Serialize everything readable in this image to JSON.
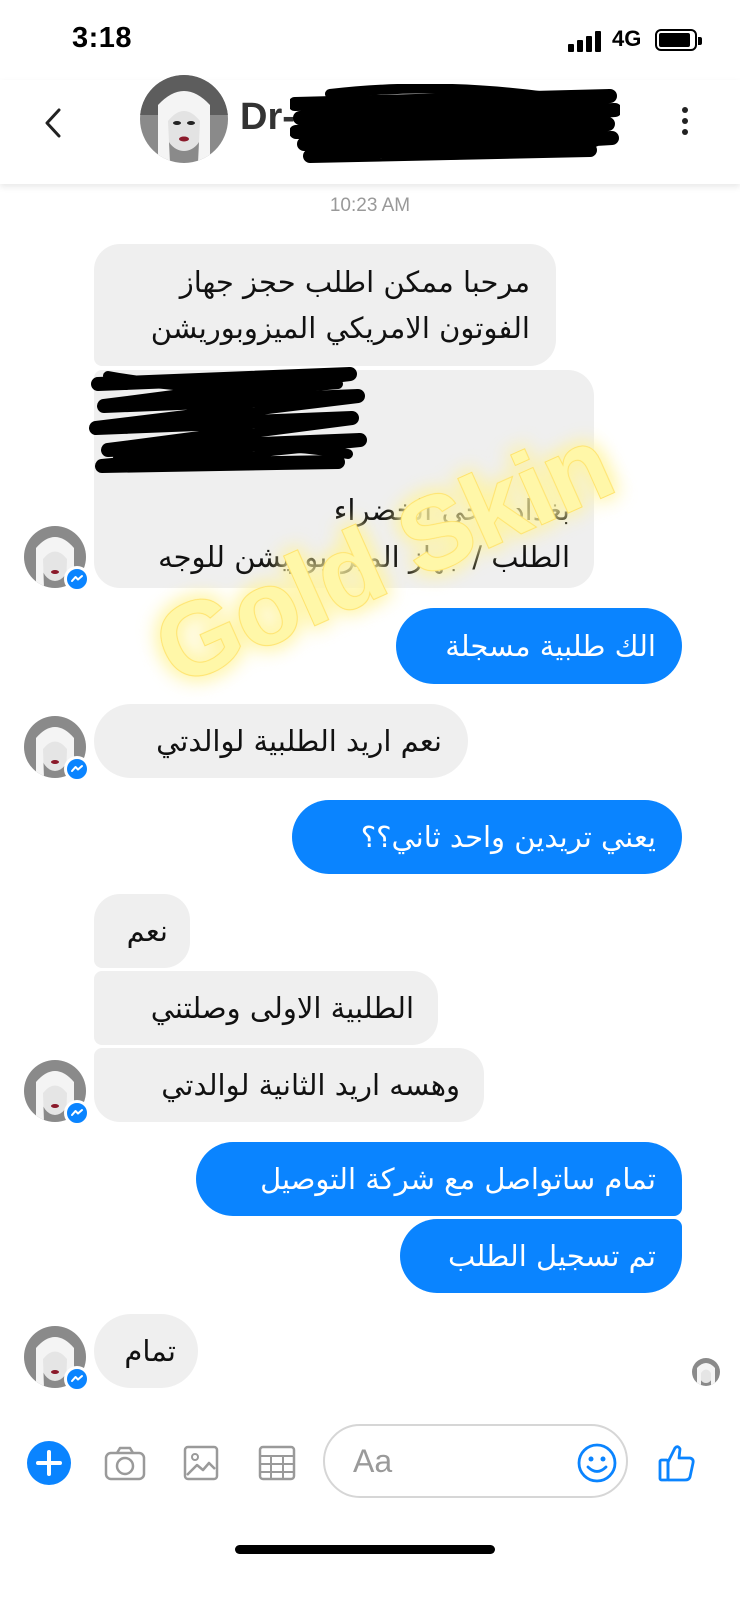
{
  "status_bar": {
    "time": "3:18",
    "network": "4G"
  },
  "header": {
    "contact_name": "Dr-"
  },
  "thread": {
    "timestamp": "10:23 AM",
    "messages": [
      {
        "side": "in",
        "lines": [
          "مرحبا ممكن اطلب حجز جهاز",
          "الفوتون الامريكي الميزوبوريشن"
        ]
      },
      {
        "side": "in",
        "lines": [
          "بغداد / حي الخضراء",
          "الطلب / جهاز الميزوبوريشن للوجه"
        ]
      },
      {
        "side": "out",
        "lines": [
          "الك طلبية مسجلة"
        ]
      },
      {
        "side": "in",
        "lines": [
          "نعم اريد الطلبية لوالدتي"
        ]
      },
      {
        "side": "out",
        "lines": [
          "يعني  تريدين واحد ثاني؟؟"
        ]
      },
      {
        "side": "in",
        "lines": [
          "نعم"
        ]
      },
      {
        "side": "in",
        "lines": [
          "الطلبية الاولى وصلتني"
        ]
      },
      {
        "side": "in",
        "lines": [
          "وهسه اريد الثانية لوالدتي"
        ]
      },
      {
        "side": "out",
        "lines": [
          "تمام ساتواصل مع شركة التوصيل"
        ]
      },
      {
        "side": "out",
        "lines": [
          "تم تسجيل الطلب"
        ]
      },
      {
        "side": "in",
        "lines": [
          "تمام"
        ]
      }
    ]
  },
  "watermark": {
    "text": "Gold Skin"
  },
  "composer": {
    "placeholder": "Aa"
  },
  "colors": {
    "accent": "#0a84ff",
    "incoming_bubble": "#efefef",
    "watermark": "#fff7a8"
  },
  "icons": [
    "chevron-left-icon",
    "more-vertical-icon",
    "plus-icon",
    "camera-icon",
    "image-icon",
    "sticker-grid-icon",
    "emoji-icon",
    "thumbs-up-icon",
    "messenger-badge-icon"
  ]
}
